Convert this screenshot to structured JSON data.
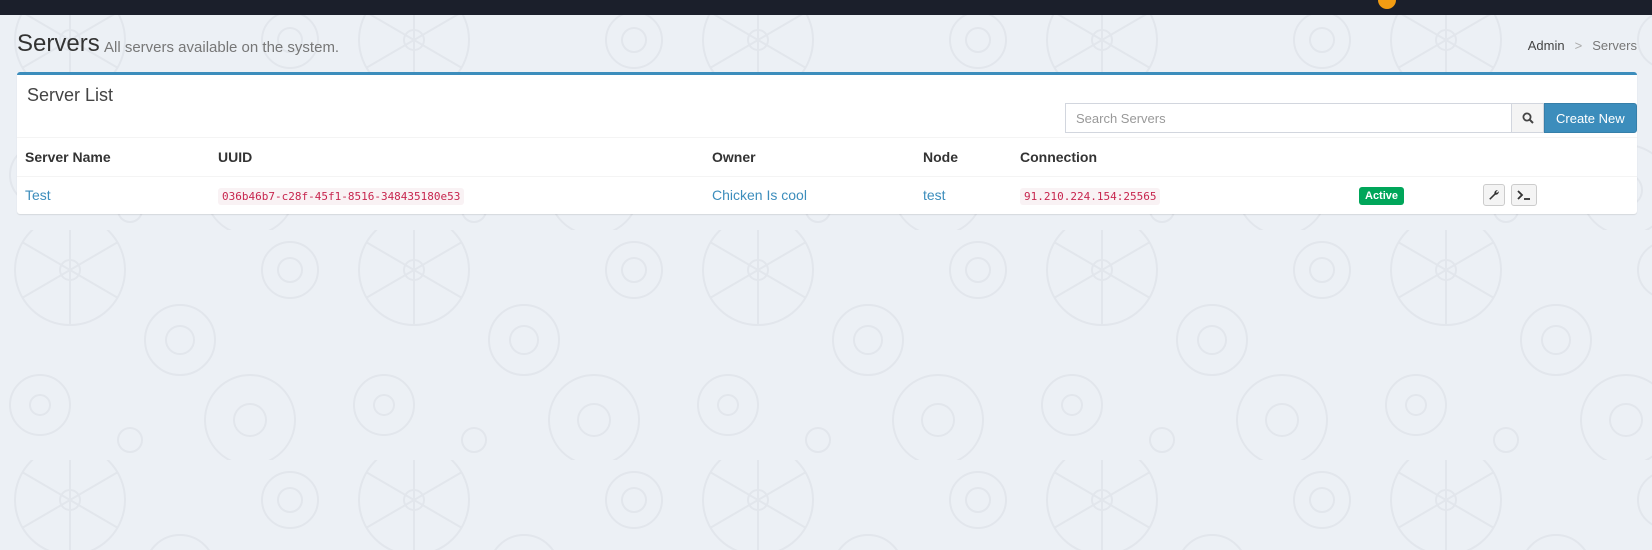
{
  "header": {
    "title": "Servers",
    "subtitle": "All servers available on the system.",
    "breadcrumb": [
      {
        "label": "Admin"
      },
      {
        "label": "Servers"
      }
    ],
    "breadcrumb_separator": ">"
  },
  "box": {
    "title": "Server List",
    "search": {
      "placeholder": "Search Servers",
      "value": ""
    },
    "create_label": "Create New"
  },
  "table": {
    "columns": [
      "Server Name",
      "UUID",
      "Owner",
      "Node",
      "Connection",
      "",
      ""
    ],
    "rows": [
      {
        "name": "Test",
        "uuid": "036b46b7-c28f-45f1-8516-348435180e53",
        "owner": "Chicken Is cool",
        "node": "test",
        "connection": "91.210.224.154:25565",
        "status": "Active"
      }
    ]
  },
  "colors": {
    "accent": "#3c8dbc",
    "status_active": "#00a65a",
    "topbar": "#1b1f2b",
    "background": "#ecf0f5",
    "code_text": "#c7254e"
  },
  "icons": {
    "search": "search-icon",
    "manage": "wrench-icon",
    "console": "terminal-icon"
  }
}
